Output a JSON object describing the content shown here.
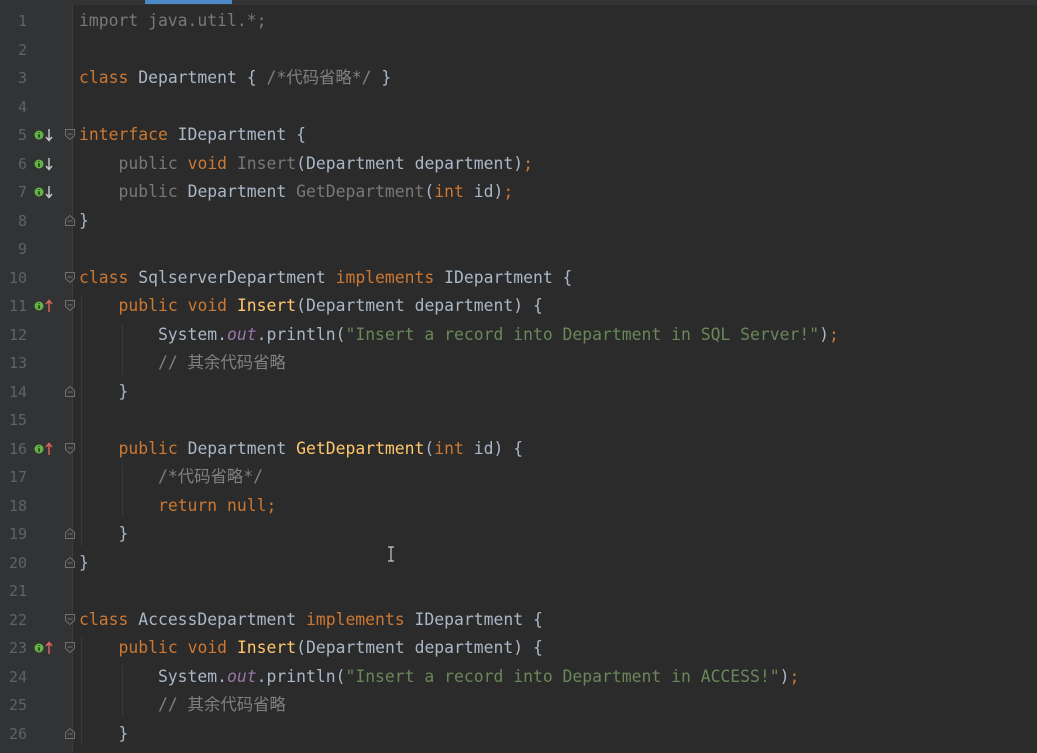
{
  "editor": {
    "lines": [
      {
        "n": "1",
        "tokens": [
          {
            "t": "import java.util.*;",
            "c": "dim"
          }
        ]
      },
      {
        "n": "2",
        "tokens": []
      },
      {
        "n": "3",
        "tokens": [
          {
            "t": "class",
            "c": "kw"
          },
          {
            "t": " Department { ",
            "c": "cls"
          },
          {
            "t": "/*代码省略*/",
            "c": "cmt"
          },
          {
            "t": " }",
            "c": "cls"
          }
        ]
      },
      {
        "n": "4",
        "tokens": []
      },
      {
        "n": "5",
        "tokens": [
          {
            "t": "interface",
            "c": "kw"
          },
          {
            "t": " IDepartment {",
            "c": "cls"
          }
        ],
        "gutter": "implemented-down",
        "fold": "open"
      },
      {
        "n": "6",
        "tokens": [
          {
            "t": "    ",
            "c": "cls"
          },
          {
            "t": "public",
            "c": "dim"
          },
          {
            "t": " ",
            "c": "cls"
          },
          {
            "t": "void",
            "c": "kw"
          },
          {
            "t": " ",
            "c": "cls"
          },
          {
            "t": "Insert",
            "c": "dim"
          },
          {
            "t": "(Department department)",
            "c": "cls"
          },
          {
            "t": ";",
            "c": "kw"
          }
        ],
        "gutter": "implemented-down"
      },
      {
        "n": "7",
        "tokens": [
          {
            "t": "    ",
            "c": "cls"
          },
          {
            "t": "public",
            "c": "dim"
          },
          {
            "t": " Department ",
            "c": "cls"
          },
          {
            "t": "GetDepartment",
            "c": "dim"
          },
          {
            "t": "(",
            "c": "cls"
          },
          {
            "t": "int",
            "c": "kw"
          },
          {
            "t": " id)",
            "c": "cls"
          },
          {
            "t": ";",
            "c": "kw"
          }
        ],
        "gutter": "implemented-down"
      },
      {
        "n": "8",
        "tokens": [
          {
            "t": "}",
            "c": "cls"
          }
        ],
        "fold": "close"
      },
      {
        "n": "9",
        "tokens": []
      },
      {
        "n": "10",
        "tokens": [
          {
            "t": "class",
            "c": "kw"
          },
          {
            "t": " SqlserverDepartment ",
            "c": "cls"
          },
          {
            "t": "implements",
            "c": "kw"
          },
          {
            "t": " IDepartment {",
            "c": "cls"
          }
        ],
        "fold": "open"
      },
      {
        "n": "11",
        "tokens": [
          {
            "t": "    ",
            "c": "cls"
          },
          {
            "t": "public",
            "c": "kw"
          },
          {
            "t": " ",
            "c": "cls"
          },
          {
            "t": "void",
            "c": "kw"
          },
          {
            "t": " ",
            "c": "cls"
          },
          {
            "t": "Insert",
            "c": "mth"
          },
          {
            "t": "(Department department) {",
            "c": "cls"
          }
        ],
        "gutter": "implements-up",
        "fold": "open"
      },
      {
        "n": "12",
        "tokens": [
          {
            "t": "        System.",
            "c": "cls"
          },
          {
            "t": "out",
            "c": "fld"
          },
          {
            "t": ".println(",
            "c": "cls"
          },
          {
            "t": "\"Insert a record into Department in SQL Server!\"",
            "c": "str"
          },
          {
            "t": ")",
            "c": "cls"
          },
          {
            "t": ";",
            "c": "kw"
          }
        ]
      },
      {
        "n": "13",
        "tokens": [
          {
            "t": "        ",
            "c": "cls"
          },
          {
            "t": "// 其余代码省略",
            "c": "cmt"
          }
        ]
      },
      {
        "n": "14",
        "tokens": [
          {
            "t": "    }",
            "c": "cls"
          }
        ],
        "fold": "close"
      },
      {
        "n": "15",
        "tokens": []
      },
      {
        "n": "16",
        "tokens": [
          {
            "t": "    ",
            "c": "cls"
          },
          {
            "t": "public",
            "c": "kw"
          },
          {
            "t": " Department ",
            "c": "cls"
          },
          {
            "t": "GetDepartment",
            "c": "mth"
          },
          {
            "t": "(",
            "c": "cls"
          },
          {
            "t": "int",
            "c": "kw"
          },
          {
            "t": " id) {",
            "c": "cls"
          }
        ],
        "gutter": "implements-up",
        "fold": "open"
      },
      {
        "n": "17",
        "tokens": [
          {
            "t": "        ",
            "c": "cls"
          },
          {
            "t": "/*代码省略*/",
            "c": "cmt"
          }
        ]
      },
      {
        "n": "18",
        "tokens": [
          {
            "t": "        ",
            "c": "cls"
          },
          {
            "t": "return null;",
            "c": "kw"
          }
        ]
      },
      {
        "n": "19",
        "tokens": [
          {
            "t": "    }",
            "c": "cls"
          }
        ],
        "fold": "close"
      },
      {
        "n": "20",
        "tokens": [
          {
            "t": "}",
            "c": "cls"
          }
        ],
        "fold": "close"
      },
      {
        "n": "21",
        "tokens": []
      },
      {
        "n": "22",
        "tokens": [
          {
            "t": "class",
            "c": "kw"
          },
          {
            "t": " AccessDepartment ",
            "c": "cls"
          },
          {
            "t": "implements",
            "c": "kw"
          },
          {
            "t": " IDepartment {",
            "c": "cls"
          }
        ],
        "fold": "open"
      },
      {
        "n": "23",
        "tokens": [
          {
            "t": "    ",
            "c": "cls"
          },
          {
            "t": "public",
            "c": "kw"
          },
          {
            "t": " ",
            "c": "cls"
          },
          {
            "t": "void",
            "c": "kw"
          },
          {
            "t": " ",
            "c": "cls"
          },
          {
            "t": "Insert",
            "c": "mth"
          },
          {
            "t": "(Department department) {",
            "c": "cls"
          }
        ],
        "gutter": "implements-up",
        "fold": "open"
      },
      {
        "n": "24",
        "tokens": [
          {
            "t": "        System.",
            "c": "cls"
          },
          {
            "t": "out",
            "c": "fld"
          },
          {
            "t": ".println(",
            "c": "cls"
          },
          {
            "t": "\"Insert a record into Department in ACCESS!\"",
            "c": "str"
          },
          {
            "t": ")",
            "c": "cls"
          },
          {
            "t": ";",
            "c": "kw"
          }
        ]
      },
      {
        "n": "25",
        "tokens": [
          {
            "t": "        ",
            "c": "cls"
          },
          {
            "t": "// 其余代码省略",
            "c": "cmt"
          }
        ]
      },
      {
        "n": "26",
        "tokens": [
          {
            "t": "    }",
            "c": "cls"
          }
        ],
        "fold": "close"
      }
    ]
  },
  "colors": {
    "background": "#2b2b2b",
    "gutter": "#313335",
    "keyword": "#cc7832",
    "method": "#ffc66d",
    "string": "#6a8759",
    "comment": "#808080",
    "field": "#9876aa",
    "text": "#a9b7c6",
    "implements_marker": "#e0655d",
    "implemented_marker": "#62b543"
  }
}
